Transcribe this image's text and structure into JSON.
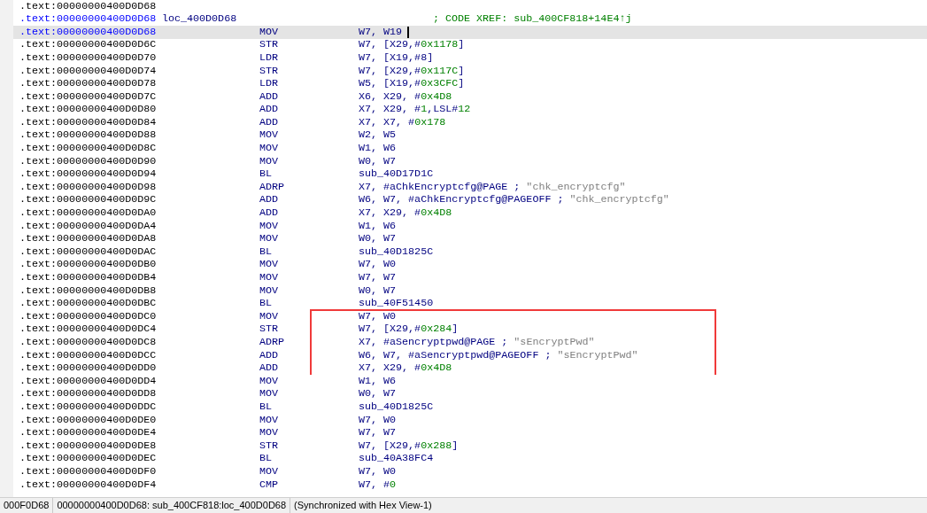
{
  "blocks": [
    {
      "boxed": false,
      "rows": [
        {
          "address": ".text:00000000400D0D68",
          "selected": false
        },
        {
          "address": ".text:00000000400D0D68",
          "label": "loc_400D0D68",
          "comment": [
            {
              "text": "; CODE XREF: sub_400CF818+14E4↑j",
              "kind": "xref"
            }
          ],
          "selected": false
        },
        {
          "address": ".text:00000000400D0D68",
          "mnemonic": "MOV",
          "operands": [
            {
              "text": "W7, W19",
              "kind": "reg"
            }
          ],
          "selected": true
        },
        {
          "address": ".text:00000000400D0D6C",
          "mnemonic": "STR",
          "operands": [
            {
              "text": "W7, [X29,#",
              "kind": "reg"
            },
            {
              "text": "0x1178",
              "kind": "num"
            },
            {
              "text": "]",
              "kind": "reg"
            }
          ],
          "selected": false
        },
        {
          "address": ".text:00000000400D0D70",
          "mnemonic": "LDR",
          "operands": [
            {
              "text": "W7, [X19,#8]",
              "kind": "reg"
            }
          ],
          "selected": false
        },
        {
          "address": ".text:00000000400D0D74",
          "mnemonic": "STR",
          "operands": [
            {
              "text": "W7, [X29,#",
              "kind": "reg"
            },
            {
              "text": "0x117C",
              "kind": "num"
            },
            {
              "text": "]",
              "kind": "reg"
            }
          ],
          "selected": false
        },
        {
          "address": ".text:00000000400D0D78",
          "mnemonic": "LDR",
          "operands": [
            {
              "text": "W5, [X19,#",
              "kind": "reg"
            },
            {
              "text": "0x3CFC",
              "kind": "num"
            },
            {
              "text": "]",
              "kind": "reg"
            }
          ],
          "selected": false
        },
        {
          "address": ".text:00000000400D0D7C",
          "mnemonic": "ADD",
          "operands": [
            {
              "text": "X6, X29, #",
              "kind": "reg"
            },
            {
              "text": "0x4D8",
              "kind": "num"
            }
          ],
          "selected": false
        },
        {
          "address": ".text:00000000400D0D80",
          "mnemonic": "ADD",
          "operands": [
            {
              "text": "X7, X29, #",
              "kind": "reg"
            },
            {
              "text": "1",
              "kind": "num"
            },
            {
              "text": ",LSL#",
              "kind": "reg"
            },
            {
              "text": "12",
              "kind": "num"
            }
          ],
          "selected": false
        },
        {
          "address": ".text:00000000400D0D84",
          "mnemonic": "ADD",
          "operands": [
            {
              "text": "X7, X7, #",
              "kind": "reg"
            },
            {
              "text": "0x178",
              "kind": "num"
            }
          ],
          "selected": false
        },
        {
          "address": ".text:00000000400D0D88",
          "mnemonic": "MOV",
          "operands": [
            {
              "text": "W2, W5",
              "kind": "reg"
            }
          ],
          "selected": false
        },
        {
          "address": ".text:00000000400D0D8C",
          "mnemonic": "MOV",
          "operands": [
            {
              "text": "W1, W6",
              "kind": "reg"
            }
          ],
          "selected": false
        },
        {
          "address": ".text:00000000400D0D90",
          "mnemonic": "MOV",
          "operands": [
            {
              "text": "W0, W7",
              "kind": "reg"
            }
          ],
          "selected": false
        },
        {
          "address": ".text:00000000400D0D94",
          "mnemonic": "BL",
          "operands": [
            {
              "text": "sub_40D17D1C",
              "kind": "reg"
            }
          ],
          "selected": false
        },
        {
          "address": ".text:00000000400D0D98",
          "mnemonic": "ADRP",
          "operands": [
            {
              "text": "X7, #aChkEncryptcfg@PAGE",
              "kind": "reg"
            }
          ],
          "comment": [
            {
              "text": " ;",
              "kind": "sep"
            },
            {
              "text": " \"chk_encryptcfg\"",
              "kind": "string"
            }
          ],
          "selected": false
        },
        {
          "address": ".text:00000000400D0D9C",
          "mnemonic": "ADD",
          "operands": [
            {
              "text": "W6, W7, #aChkEncryptcfg@PAGEOFF",
              "kind": "reg"
            }
          ],
          "comment": [
            {
              "text": " ;",
              "kind": "sep"
            },
            {
              "text": " \"chk_encryptcfg\"",
              "kind": "string"
            }
          ],
          "selected": false
        },
        {
          "address": ".text:00000000400D0DA0",
          "mnemonic": "ADD",
          "operands": [
            {
              "text": "X7, X29, #",
              "kind": "reg"
            },
            {
              "text": "0x4D8",
              "kind": "num"
            }
          ],
          "selected": false
        },
        {
          "address": ".text:00000000400D0DA4",
          "mnemonic": "MOV",
          "operands": [
            {
              "text": "W1, W6",
              "kind": "reg"
            }
          ],
          "selected": false
        },
        {
          "address": ".text:00000000400D0DA8",
          "mnemonic": "MOV",
          "operands": [
            {
              "text": "W0, W7",
              "kind": "reg"
            }
          ],
          "selected": false
        },
        {
          "address": ".text:00000000400D0DAC",
          "mnemonic": "BL",
          "operands": [
            {
              "text": "sub_40D1825C",
              "kind": "reg"
            }
          ],
          "selected": false
        },
        {
          "address": ".text:00000000400D0DB0",
          "mnemonic": "MOV",
          "operands": [
            {
              "text": "W7, W0",
              "kind": "reg"
            }
          ],
          "selected": false
        },
        {
          "address": ".text:00000000400D0DB4",
          "mnemonic": "MOV",
          "operands": [
            {
              "text": "W7, W7",
              "kind": "reg"
            }
          ],
          "selected": false
        },
        {
          "address": ".text:00000000400D0DB8",
          "mnemonic": "MOV",
          "operands": [
            {
              "text": "W0, W7",
              "kind": "reg"
            }
          ],
          "selected": false
        },
        {
          "address": ".text:00000000400D0DBC",
          "mnemonic": "BL",
          "operands": [
            {
              "text": "sub_40F51450",
              "kind": "reg"
            }
          ],
          "selected": false
        }
      ]
    },
    {
      "boxed": true,
      "rows": [
        {
          "address": ".text:00000000400D0DC0",
          "mnemonic": "MOV",
          "operands": [
            {
              "text": "W7, W0",
              "kind": "reg"
            }
          ],
          "selected": false
        },
        {
          "address": ".text:00000000400D0DC4",
          "mnemonic": "STR",
          "operands": [
            {
              "text": "W7, [X29,#",
              "kind": "reg"
            },
            {
              "text": "0x284",
              "kind": "num"
            },
            {
              "text": "]",
              "kind": "reg"
            }
          ],
          "selected": false
        },
        {
          "address": ".text:00000000400D0DC8",
          "mnemonic": "ADRP",
          "operands": [
            {
              "text": "X7, #aSencryptpwd@PAGE",
              "kind": "reg"
            }
          ],
          "comment": [
            {
              "text": " ;",
              "kind": "sep"
            },
            {
              "text": " \"sEncryptPwd\"",
              "kind": "string"
            }
          ],
          "selected": false
        },
        {
          "address": ".text:00000000400D0DCC",
          "mnemonic": "ADD",
          "operands": [
            {
              "text": "W6, W7, #aSencryptpwd@PAGEOFF",
              "kind": "reg"
            }
          ],
          "comment": [
            {
              "text": " ;",
              "kind": "sep"
            },
            {
              "text": " \"sEncryptPwd\"",
              "kind": "string"
            }
          ],
          "selected": false
        },
        {
          "address": ".text:00000000400D0DD0",
          "mnemonic": "ADD",
          "operands": [
            {
              "text": "X7, X29, #",
              "kind": "reg"
            },
            {
              "text": "0x4D8",
              "kind": "num"
            }
          ],
          "selected": false
        }
      ]
    },
    {
      "boxed": false,
      "rows": [
        {
          "address": ".text:00000000400D0DD4",
          "mnemonic": "MOV",
          "operands": [
            {
              "text": "W1, W6",
              "kind": "reg"
            }
          ],
          "selected": false
        },
        {
          "address": ".text:00000000400D0DD8",
          "mnemonic": "MOV",
          "operands": [
            {
              "text": "W0, W7",
              "kind": "reg"
            }
          ],
          "selected": false
        },
        {
          "address": ".text:00000000400D0DDC",
          "mnemonic": "BL",
          "operands": [
            {
              "text": "sub_40D1825C",
              "kind": "reg"
            }
          ],
          "selected": false
        },
        {
          "address": ".text:00000000400D0DE0",
          "mnemonic": "MOV",
          "operands": [
            {
              "text": "W7, W0",
              "kind": "reg"
            }
          ],
          "selected": false
        },
        {
          "address": ".text:00000000400D0DE4",
          "mnemonic": "MOV",
          "operands": [
            {
              "text": "W7, W7",
              "kind": "reg"
            }
          ],
          "selected": false
        },
        {
          "address": ".text:00000000400D0DE8",
          "mnemonic": "STR",
          "operands": [
            {
              "text": "W7, [X29,#",
              "kind": "reg"
            },
            {
              "text": "0x288",
              "kind": "num"
            },
            {
              "text": "]",
              "kind": "reg"
            }
          ],
          "selected": false
        },
        {
          "address": ".text:00000000400D0DEC",
          "mnemonic": "BL",
          "operands": [
            {
              "text": "sub_40A38FC4",
              "kind": "reg"
            }
          ],
          "selected": false
        },
        {
          "address": ".text:00000000400D0DF0",
          "mnemonic": "MOV",
          "operands": [
            {
              "text": "W7, W0",
              "kind": "reg"
            }
          ],
          "selected": false
        },
        {
          "address": ".text:00000000400D0DF4",
          "mnemonic": "CMP",
          "operands": [
            {
              "text": "W7, #",
              "kind": "reg"
            },
            {
              "text": "0",
              "kind": "num"
            }
          ],
          "selected": false
        }
      ]
    }
  ],
  "status_bar": [
    "000F0D68",
    "00000000400D0D68: sub_400CF818:loc_400D0D68",
    "(Synchronized with Hex View-1)"
  ]
}
